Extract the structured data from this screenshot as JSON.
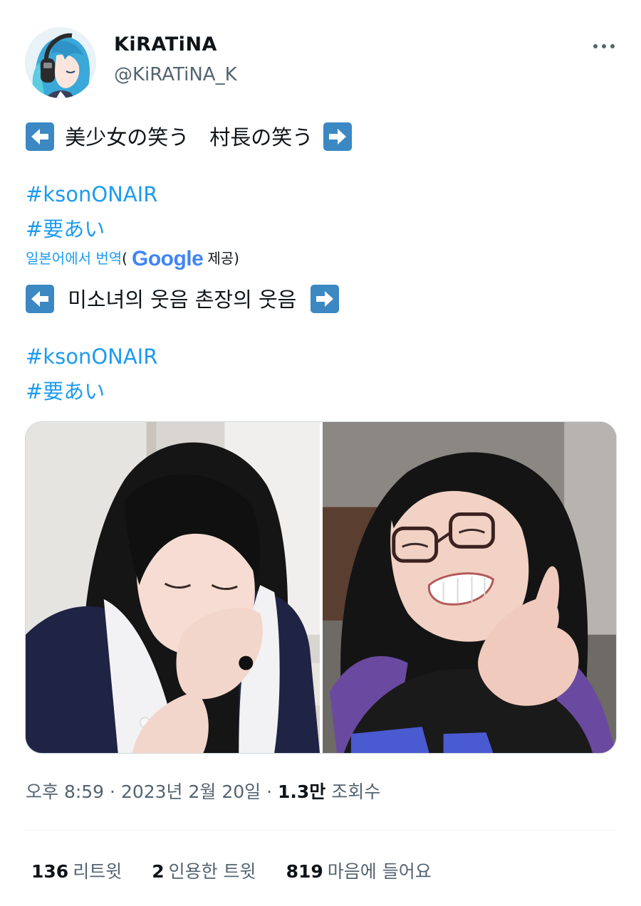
{
  "author": {
    "display_name": "KiRATiNA",
    "handle": "@KiRATiNA_K",
    "avatar_icon": "anime-avatar-headphones",
    "more_icon": "more-dots-icon"
  },
  "tweet": {
    "original_line": "美少女の笑う　村長の笑う",
    "hashtags": [
      "#ksonONAIR",
      "#要あい"
    ],
    "translation_link": "일본어에서 번역",
    "translation_open": "(",
    "translation_brand": "Google",
    "translation_close": "제공)",
    "translated_line": "미소녀의 웃음 촌장의 웃음",
    "translated_hashtags": [
      "#ksonONAIR",
      "#要あい"
    ],
    "emoji_left": "left-arrow-emoji",
    "emoji_right": "right-arrow-emoji"
  },
  "media": {
    "photos": [
      "photo-girl-laughing",
      "photo-glasses-laughing"
    ]
  },
  "meta": {
    "time": "오후 8:59",
    "sep1": " · ",
    "date": "2023년 2월 20일",
    "sep2": " · ",
    "views_count": "1.3만",
    "views_label": "조회수"
  },
  "stats": {
    "retweets_count": "136",
    "retweets_label": "리트윗",
    "quotes_count": "2",
    "quotes_label": "인용한 트윗",
    "likes_count": "819",
    "likes_label": "마음에 들어요"
  },
  "colors": {
    "link": "#1d9bf0",
    "secondary": "#536471",
    "primary": "#0f1419",
    "emoji_blue": "#3b88c3"
  }
}
